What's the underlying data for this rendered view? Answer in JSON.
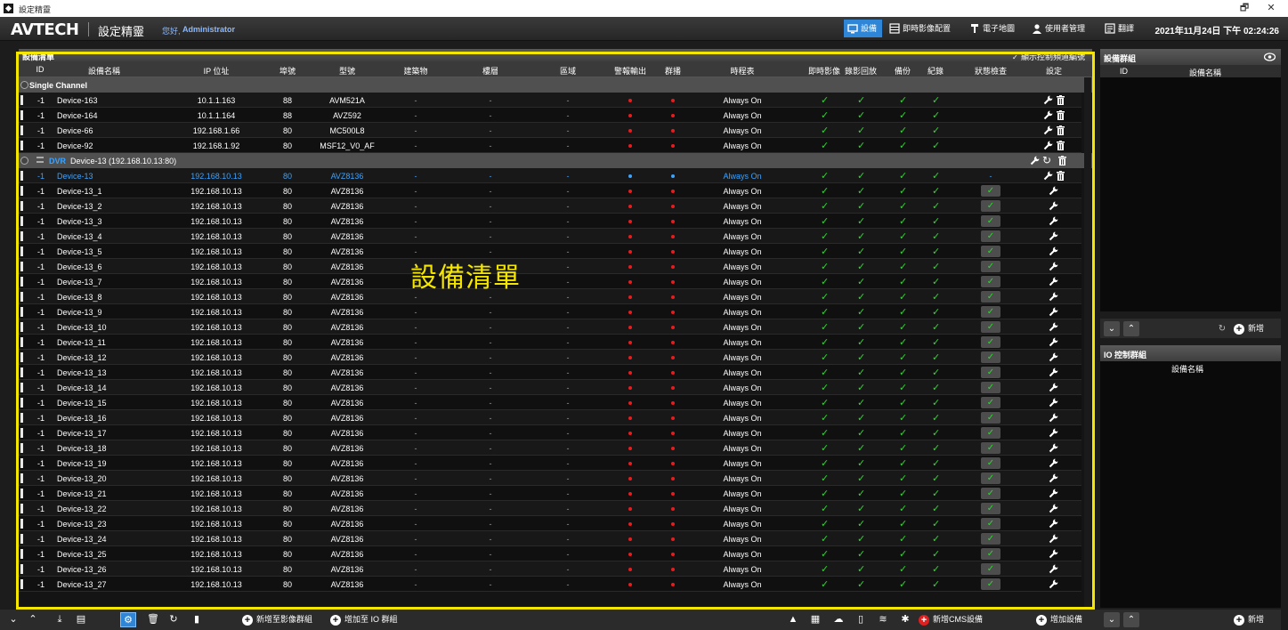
{
  "window": {
    "title": "設定精靈",
    "restore": "🗗",
    "close": "✕"
  },
  "header": {
    "logo": "AVTECH",
    "app_name": "設定精靈",
    "greeting": "您好,",
    "user": "Administrator",
    "nav": [
      {
        "label": "設備",
        "icon": "monitor-icon",
        "active": true
      },
      {
        "label": "即時影像配置",
        "icon": "grid-icon",
        "active": false
      },
      {
        "label": "電子地圖",
        "icon": "pin-icon",
        "active": false
      },
      {
        "label": "使用者管理",
        "icon": "user-icon",
        "active": false
      },
      {
        "label": "翻譯",
        "icon": "translate-icon",
        "active": false
      }
    ],
    "datetime": "2021年11月24日 下午 02:24:26"
  },
  "device_panel": {
    "title": "設備清單",
    "show_channel_label": "顯示控制頻道編號",
    "show_channel_checked": true,
    "overlay_label": "設備清單",
    "columns": [
      "ID",
      "設備名稱",
      "IP 位址",
      "埠號",
      "型號",
      "建築物",
      "樓層",
      "區域",
      "警報輸出",
      "群播",
      "時程表",
      "即時影像",
      "錄影回放",
      "備份",
      "紀錄",
      "狀態檢查",
      "設定"
    ],
    "single_group_label": "Single Channel",
    "single_rows": [
      {
        "id": "-1",
        "name": "Device-163",
        "ip": "10.1.1.163",
        "port": "88",
        "model": "AVM521A",
        "building": "-",
        "floor": "-",
        "area": "-",
        "schedule": "Always On"
      },
      {
        "id": "-1",
        "name": "Device-164",
        "ip": "10.1.1.164",
        "port": "88",
        "model": "AVZ592",
        "building": "-",
        "floor": "-",
        "area": "-",
        "schedule": "Always On"
      },
      {
        "id": "-1",
        "name": "Device-66",
        "ip": "192.168.1.66",
        "port": "80",
        "model": "MC500L8",
        "building": "-",
        "floor": "-",
        "area": "-",
        "schedule": "Always On"
      },
      {
        "id": "-1",
        "name": "Device-92",
        "ip": "192.168.1.92",
        "port": "80",
        "model": "MSF12_V0_AF",
        "building": "-",
        "floor": "-",
        "area": "-",
        "schedule": "Always On"
      }
    ],
    "dvr_group": {
      "type": "DVR",
      "label": "Device-13  (192.168.10.13:80)"
    },
    "dvr_main_row": {
      "id": "-1",
      "name": "Device-13",
      "ip": "192.168.10.13",
      "port": "80",
      "model": "AVZ8136",
      "building": "-",
      "floor": "-",
      "area": "-",
      "schedule": "Always On",
      "status": "-"
    },
    "channel_rows": [
      {
        "id": "-1",
        "name": "Device-13_1",
        "ip": "192.168.10.13",
        "port": "80",
        "model": "AVZ8136",
        "building": "-",
        "floor": "-",
        "area": "-",
        "schedule": "Always On"
      },
      {
        "id": "-1",
        "name": "Device-13_2",
        "ip": "192.168.10.13",
        "port": "80",
        "model": "AVZ8136",
        "building": "-",
        "floor": "-",
        "area": "-",
        "schedule": "Always On"
      },
      {
        "id": "-1",
        "name": "Device-13_3",
        "ip": "192.168.10.13",
        "port": "80",
        "model": "AVZ8136",
        "building": "-",
        "floor": "-",
        "area": "-",
        "schedule": "Always On"
      },
      {
        "id": "-1",
        "name": "Device-13_4",
        "ip": "192.168.10.13",
        "port": "80",
        "model": "AVZ8136",
        "building": "-",
        "floor": "-",
        "area": "-",
        "schedule": "Always On"
      },
      {
        "id": "-1",
        "name": "Device-13_5",
        "ip": "192.168.10.13",
        "port": "80",
        "model": "AVZ8136",
        "building": "-",
        "floor": "-",
        "area": "-",
        "schedule": "Always On"
      },
      {
        "id": "-1",
        "name": "Device-13_6",
        "ip": "192.168.10.13",
        "port": "80",
        "model": "AVZ8136",
        "building": "-",
        "floor": "-",
        "area": "-",
        "schedule": "Always On"
      },
      {
        "id": "-1",
        "name": "Device-13_7",
        "ip": "192.168.10.13",
        "port": "80",
        "model": "AVZ8136",
        "building": "-",
        "floor": "-",
        "area": "-",
        "schedule": "Always On"
      },
      {
        "id": "-1",
        "name": "Device-13_8",
        "ip": "192.168.10.13",
        "port": "80",
        "model": "AVZ8136",
        "building": "-",
        "floor": "-",
        "area": "-",
        "schedule": "Always On"
      },
      {
        "id": "-1",
        "name": "Device-13_9",
        "ip": "192.168.10.13",
        "port": "80",
        "model": "AVZ8136",
        "building": "-",
        "floor": "-",
        "area": "-",
        "schedule": "Always On"
      },
      {
        "id": "-1",
        "name": "Device-13_10",
        "ip": "192.168.10.13",
        "port": "80",
        "model": "AVZ8136",
        "building": "-",
        "floor": "-",
        "area": "-",
        "schedule": "Always On"
      },
      {
        "id": "-1",
        "name": "Device-13_11",
        "ip": "192.168.10.13",
        "port": "80",
        "model": "AVZ8136",
        "building": "-",
        "floor": "-",
        "area": "-",
        "schedule": "Always On"
      },
      {
        "id": "-1",
        "name": "Device-13_12",
        "ip": "192.168.10.13",
        "port": "80",
        "model": "AVZ8136",
        "building": "-",
        "floor": "-",
        "area": "-",
        "schedule": "Always On"
      },
      {
        "id": "-1",
        "name": "Device-13_13",
        "ip": "192.168.10.13",
        "port": "80",
        "model": "AVZ8136",
        "building": "-",
        "floor": "-",
        "area": "-",
        "schedule": "Always On"
      },
      {
        "id": "-1",
        "name": "Device-13_14",
        "ip": "192.168.10.13",
        "port": "80",
        "model": "AVZ8136",
        "building": "-",
        "floor": "-",
        "area": "-",
        "schedule": "Always On"
      },
      {
        "id": "-1",
        "name": "Device-13_15",
        "ip": "192.168.10.13",
        "port": "80",
        "model": "AVZ8136",
        "building": "-",
        "floor": "-",
        "area": "-",
        "schedule": "Always On"
      },
      {
        "id": "-1",
        "name": "Device-13_16",
        "ip": "192.168.10.13",
        "port": "80",
        "model": "AVZ8136",
        "building": "-",
        "floor": "-",
        "area": "-",
        "schedule": "Always On"
      },
      {
        "id": "-1",
        "name": "Device-13_17",
        "ip": "192.168.10.13",
        "port": "80",
        "model": "AVZ8136",
        "building": "-",
        "floor": "-",
        "area": "-",
        "schedule": "Always On"
      },
      {
        "id": "-1",
        "name": "Device-13_18",
        "ip": "192.168.10.13",
        "port": "80",
        "model": "AVZ8136",
        "building": "-",
        "floor": "-",
        "area": "-",
        "schedule": "Always On"
      },
      {
        "id": "-1",
        "name": "Device-13_19",
        "ip": "192.168.10.13",
        "port": "80",
        "model": "AVZ8136",
        "building": "-",
        "floor": "-",
        "area": "-",
        "schedule": "Always On"
      },
      {
        "id": "-1",
        "name": "Device-13_20",
        "ip": "192.168.10.13",
        "port": "80",
        "model": "AVZ8136",
        "building": "-",
        "floor": "-",
        "area": "-",
        "schedule": "Always On"
      },
      {
        "id": "-1",
        "name": "Device-13_21",
        "ip": "192.168.10.13",
        "port": "80",
        "model": "AVZ8136",
        "building": "-",
        "floor": "-",
        "area": "-",
        "schedule": "Always On"
      },
      {
        "id": "-1",
        "name": "Device-13_22",
        "ip": "192.168.10.13",
        "port": "80",
        "model": "AVZ8136",
        "building": "-",
        "floor": "-",
        "area": "-",
        "schedule": "Always On"
      },
      {
        "id": "-1",
        "name": "Device-13_23",
        "ip": "192.168.10.13",
        "port": "80",
        "model": "AVZ8136",
        "building": "-",
        "floor": "-",
        "area": "-",
        "schedule": "Always On"
      },
      {
        "id": "-1",
        "name": "Device-13_24",
        "ip": "192.168.10.13",
        "port": "80",
        "model": "AVZ8136",
        "building": "-",
        "floor": "-",
        "area": "-",
        "schedule": "Always On"
      },
      {
        "id": "-1",
        "name": "Device-13_25",
        "ip": "192.168.10.13",
        "port": "80",
        "model": "AVZ8136",
        "building": "-",
        "floor": "-",
        "area": "-",
        "schedule": "Always On"
      },
      {
        "id": "-1",
        "name": "Device-13_26",
        "ip": "192.168.10.13",
        "port": "80",
        "model": "AVZ8136",
        "building": "-",
        "floor": "-",
        "area": "-",
        "schedule": "Always On"
      },
      {
        "id": "-1",
        "name": "Device-13_27",
        "ip": "192.168.10.13",
        "port": "80",
        "model": "AVZ8136",
        "building": "-",
        "floor": "-",
        "area": "-",
        "schedule": "Always On"
      }
    ]
  },
  "group_panel": {
    "title": "設備群組",
    "col_id": "ID",
    "col_name": "設備名稱",
    "add_label": "新增"
  },
  "io_panel": {
    "title": "IO 控制群組",
    "col_name": "設備名稱",
    "add_label": "新增"
  },
  "bottom_toolbar": {
    "add_to_video_group": "新增至影像群組",
    "add_to_io_group": "增加至 IO 群組",
    "add_cms_device": "新增CMS設備",
    "add_device": "增加設備"
  },
  "colors": {
    "accent": "#2f86d6",
    "highlight": "#f5e600",
    "ok": "#33d633",
    "alarm": "#e81c1c",
    "selected": "#3ca3ff"
  }
}
